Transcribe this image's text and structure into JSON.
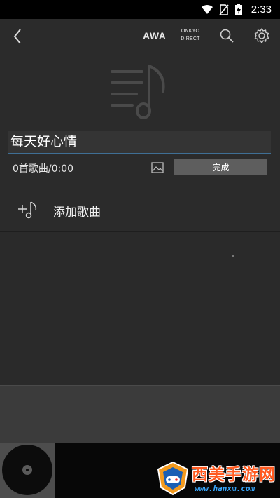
{
  "status_bar": {
    "time": "2:33",
    "icons": [
      "wifi-icon",
      "no-sim-icon",
      "battery-charging-icon"
    ]
  },
  "app_bar": {
    "back_icon": "chevron-left-icon",
    "brand_awa": "AWA",
    "brand_onkyo_line1": "ONKYO",
    "brand_onkyo_line2": "DIRECT",
    "search_icon": "search-icon",
    "settings_icon": "gear-icon"
  },
  "playlist": {
    "art_icon": "playlist-music-note-icon",
    "title_value": "每天好心情",
    "count_text": "0首歌曲/0:00",
    "image_icon": "image-icon",
    "done_label": "完成"
  },
  "add_song": {
    "icon": "add-music-icon",
    "label": "添加歌曲"
  },
  "player": {
    "disc_icon": "vinyl-disc-icon"
  },
  "watermark": {
    "brand": "西美手游网",
    "url": "www.hanxm.com"
  },
  "colors": {
    "background": "#2b2b2b",
    "field_underline": "#3f6f95",
    "done_button": "#5e5e5e",
    "watermark_brand": "#ff5a20",
    "watermark_url": "#39a9ff"
  }
}
